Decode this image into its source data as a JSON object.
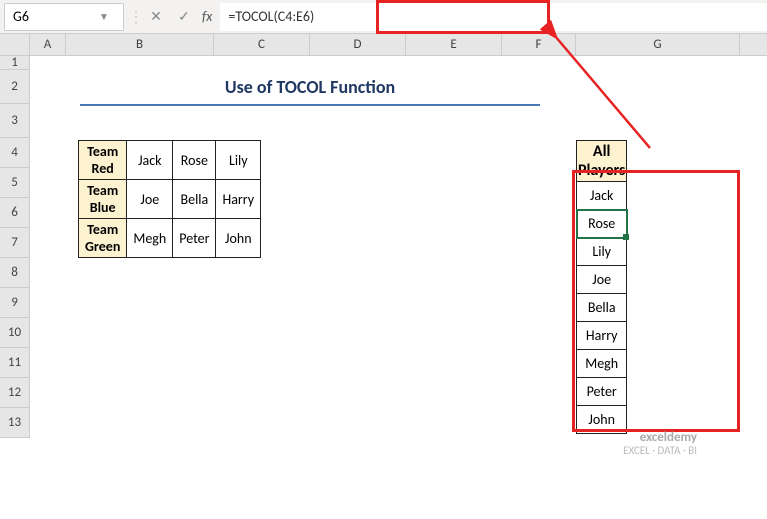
{
  "namebox": "G6",
  "formula": "=TOCOL(C4:E6)",
  "fx": "fx",
  "title": "Use of TOCOL Function",
  "cols": {
    "A": "A",
    "B": "B",
    "C": "C",
    "D": "D",
    "E": "E",
    "F": "F",
    "G": "G"
  },
  "col_widths": {
    "A": 36,
    "B": 148,
    "C": 96,
    "D": 96,
    "E": 96,
    "F": 74,
    "G": 164
  },
  "rows": [
    "1",
    "2",
    "3",
    "4",
    "5",
    "6",
    "7",
    "8",
    "9",
    "10",
    "11",
    "12",
    "13"
  ],
  "src": {
    "headers": [
      "Team Red",
      "Team Blue",
      "Team Green"
    ],
    "data": [
      [
        "Jack",
        "Rose",
        "Lily"
      ],
      [
        "Joe",
        "Bella",
        "Harry"
      ],
      [
        "Megh",
        "Peter",
        "John"
      ]
    ]
  },
  "out": {
    "header": "All Players",
    "values": [
      "Jack",
      "Rose",
      "Lily",
      "Joe",
      "Bella",
      "Harry",
      "Megh",
      "Peter",
      "John"
    ],
    "active_index": 1
  },
  "watermark": {
    "brand": "exceldemy",
    "tag": "EXCEL · DATA · BI"
  },
  "chart_data": {
    "type": "table",
    "input_range": "C4:E6",
    "formula_cell": "G5",
    "active_cell": "G6",
    "input": [
      {
        "team": "Team Red",
        "players": [
          "Jack",
          "Rose",
          "Lily"
        ]
      },
      {
        "team": "Team Blue",
        "players": [
          "Joe",
          "Bella",
          "Harry"
        ]
      },
      {
        "team": "Team Green",
        "players": [
          "Megh",
          "Peter",
          "John"
        ]
      }
    ],
    "output_column": [
      "Jack",
      "Rose",
      "Lily",
      "Joe",
      "Bella",
      "Harry",
      "Megh",
      "Peter",
      "John"
    ]
  }
}
